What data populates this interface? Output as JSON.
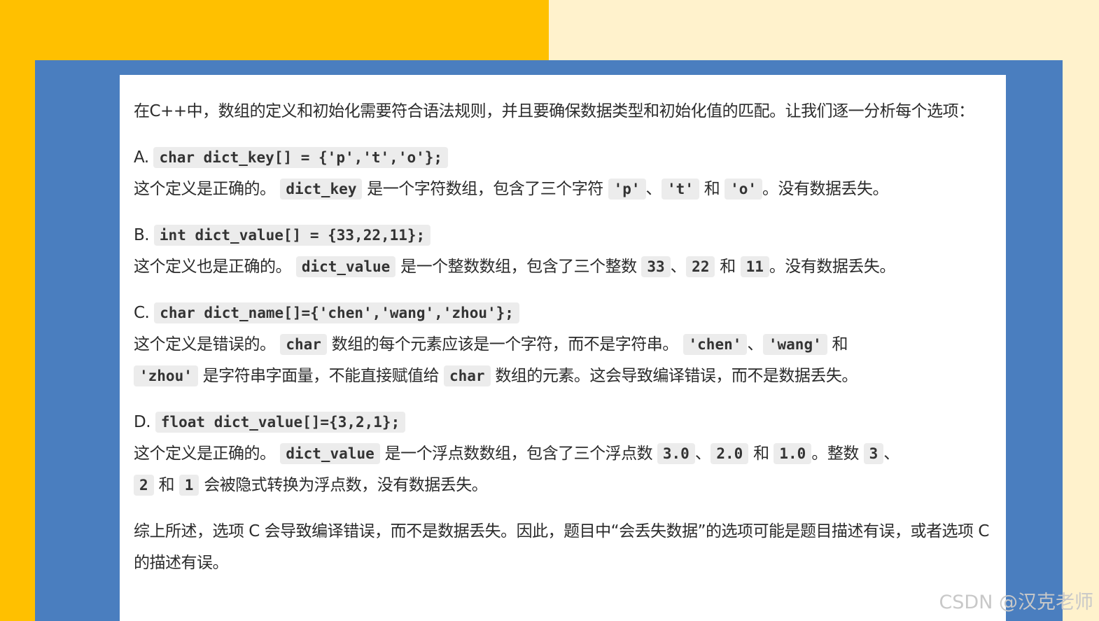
{
  "intro": "在C++中，数组的定义和初始化需要符合语法规则，并且要确保数据类型和初始化值的匹配。让我们逐一分析每个选项：",
  "options": {
    "a": {
      "label": "A.",
      "code": "char dict_key[] = {'p','t','o'};",
      "t1": "这个定义是正确的。",
      "c1": "dict_key",
      "t2": "是一个字符数组，包含了三个字符",
      "c2": "'p'",
      "t3": "、",
      "c3": "'t'",
      "t4": "和",
      "c4": "'o'",
      "t5": "。没有数据丢失。"
    },
    "b": {
      "label": "B.",
      "code": "int dict_value[] = {33,22,11};",
      "t1": "这个定义也是正确的。",
      "c1": "dict_value",
      "t2": "是一个整数数组，包含了三个整数",
      "c2": "33",
      "t3": "、",
      "c3": "22",
      "t4": "和",
      "c4": "11",
      "t5": "。没有数据丢失。"
    },
    "c": {
      "label": "C.",
      "code": "char dict_name[]={'chen','wang','zhou'};",
      "t1": "这个定义是错误的。",
      "c1": "char",
      "t2": "数组的每个元素应该是一个字符，而不是字符串。",
      "c2": "'chen'",
      "t3": "、",
      "c3": "'wang'",
      "t4": "和",
      "c4": "'zhou'",
      "t5": "是字符串字面量，不能直接赋值给",
      "c5": "char",
      "t6": "数组的元素。这会导致编译错误，而不是数据丢失。"
    },
    "d": {
      "label": "D.",
      "code": "float dict_value[]={3,2,1};",
      "t1": "这个定义是正确的。",
      "c1": "dict_value",
      "t2": "是一个浮点数数组，包含了三个浮点数",
      "c2": "3.0",
      "t3": "、",
      "c3": "2.0",
      "t4": "和",
      "c4": "1.0",
      "t5": "。整数",
      "c5": "3",
      "t6": "、",
      "c6": "2",
      "t7": "和",
      "c7": "1",
      "t8": "会被隐式转换为浮点数，没有数据丢失。"
    }
  },
  "summary": "综上所述，选项 C 会导致编译错误，而不是数据丢失。因此，题目中“会丢失数据”的选项可能是题目描述有误，或者选项 C 的描述有误。",
  "watermark": "CSDN @汉克老师",
  "colors": {
    "yellow": "#ffc000",
    "cream": "#fff2cc",
    "blue": "#4a7ebf",
    "card": "#ffffff"
  }
}
